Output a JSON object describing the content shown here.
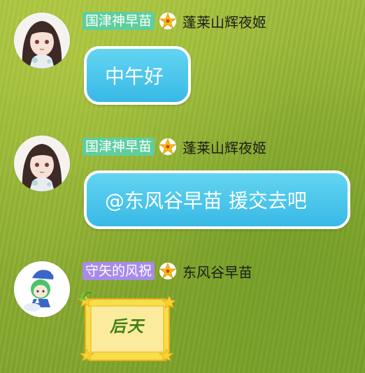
{
  "messages": [
    {
      "title_badge": "国津神早苗",
      "title_color": "#5fce9f",
      "rank_icon": "star-icon",
      "username": "蓬莱山辉夜姬",
      "text": "中午好",
      "avatar_icon": "anime-girl-dark-hair-avatar"
    },
    {
      "title_badge": "国津神早苗",
      "title_color": "#5fce9f",
      "rank_icon": "star-icon",
      "username": "蓬莱山辉夜姬",
      "text": "@东风谷早苗 援交去吧",
      "avatar_icon": "anime-girl-dark-hair-avatar"
    },
    {
      "title_badge": "守矢的风祝",
      "title_color": "#a88be8",
      "rank_icon": "star-icon",
      "username": "东风谷早苗",
      "sticker_text": "后天",
      "avatar_icon": "chibi-green-hair-avatar"
    }
  ],
  "colors": {
    "bubble": "#38b9e6",
    "sticker_frame": "#f2d53a",
    "background": "#8fb032"
  }
}
